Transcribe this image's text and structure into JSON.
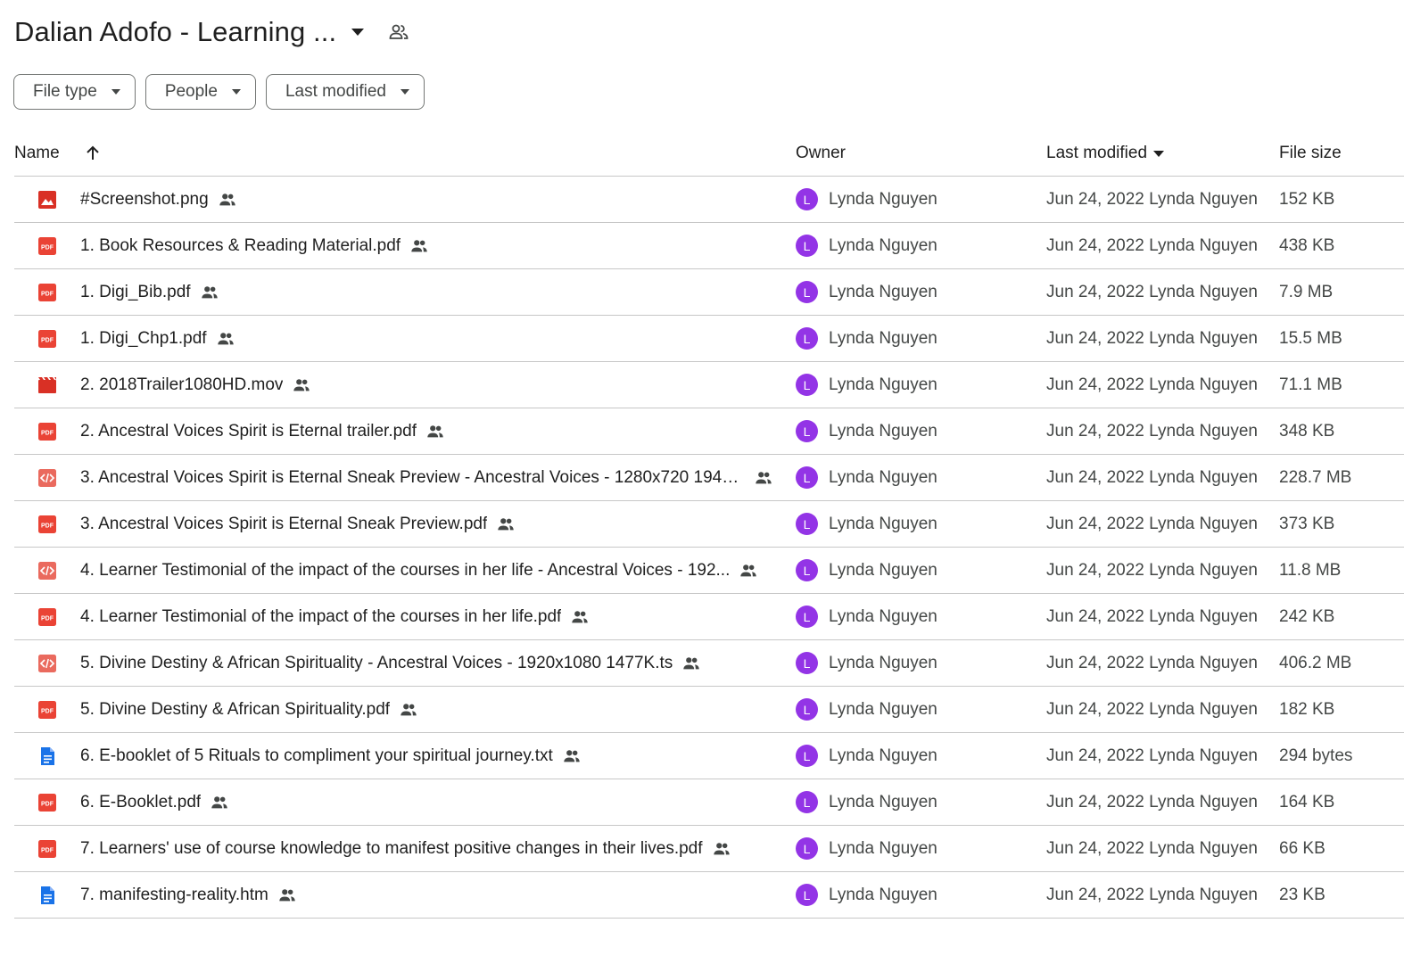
{
  "header": {
    "title": "Dalian Adofo - Learning ...",
    "title_caret": "arrow-drop-down-icon",
    "shared_icon": "shared-folder-icon"
  },
  "filters": [
    {
      "label": "File type"
    },
    {
      "label": "People"
    },
    {
      "label": "Last modified"
    }
  ],
  "columns": {
    "name": "Name",
    "owner": "Owner",
    "last_modified": "Last modified",
    "file_size": "File size"
  },
  "colors": {
    "avatar": "#9334e6",
    "pdf": "#ea4335",
    "image": "#d93025",
    "doc": "#1a73e8"
  },
  "files": [
    {
      "name": "#Screenshot.png",
      "type": "image",
      "owner_initial": "L",
      "owner": "Lynda Nguyen",
      "modified": "Jun 24, 2022 Lynda Nguyen",
      "size": "152 KB"
    },
    {
      "name": "1. Book Resources & Reading Material.pdf",
      "type": "pdf",
      "owner_initial": "L",
      "owner": "Lynda Nguyen",
      "modified": "Jun 24, 2022 Lynda Nguyen",
      "size": "438 KB"
    },
    {
      "name": "1. Digi_Bib.pdf",
      "type": "pdf",
      "owner_initial": "L",
      "owner": "Lynda Nguyen",
      "modified": "Jun 24, 2022 Lynda Nguyen",
      "size": "7.9 MB"
    },
    {
      "name": "1. Digi_Chp1.pdf",
      "type": "pdf",
      "owner_initial": "L",
      "owner": "Lynda Nguyen",
      "modified": "Jun 24, 2022 Lynda Nguyen",
      "size": "15.5 MB"
    },
    {
      "name": "2. 2018Trailer1080HD.mov",
      "type": "video",
      "owner_initial": "L",
      "owner": "Lynda Nguyen",
      "modified": "Jun 24, 2022 Lynda Nguyen",
      "size": "71.1 MB"
    },
    {
      "name": "2. Ancestral Voices Spirit is Eternal trailer.pdf",
      "type": "pdf",
      "owner_initial": "L",
      "owner": "Lynda Nguyen",
      "modified": "Jun 24, 2022 Lynda Nguyen",
      "size": "348 KB"
    },
    {
      "name": "3. Ancestral Voices Spirit is Eternal Sneak Preview - Ancestral Voices - 1280x720 1948...",
      "type": "code",
      "owner_initial": "L",
      "owner": "Lynda Nguyen",
      "modified": "Jun 24, 2022 Lynda Nguyen",
      "size": "228.7 MB"
    },
    {
      "name": "3. Ancestral Voices Spirit is Eternal Sneak Preview.pdf",
      "type": "pdf",
      "owner_initial": "L",
      "owner": "Lynda Nguyen",
      "modified": "Jun 24, 2022 Lynda Nguyen",
      "size": "373 KB"
    },
    {
      "name": "4. Learner Testimonial of the impact of the courses in her life - Ancestral Voices - 192...",
      "type": "code",
      "owner_initial": "L",
      "owner": "Lynda Nguyen",
      "modified": "Jun 24, 2022 Lynda Nguyen",
      "size": "11.8 MB"
    },
    {
      "name": "4. Learner Testimonial of the impact of the courses in her life.pdf",
      "type": "pdf",
      "owner_initial": "L",
      "owner": "Lynda Nguyen",
      "modified": "Jun 24, 2022 Lynda Nguyen",
      "size": "242 KB"
    },
    {
      "name": "5. Divine Destiny & African Spirituality - Ancestral Voices - 1920x1080 1477K.ts",
      "type": "code",
      "owner_initial": "L",
      "owner": "Lynda Nguyen",
      "modified": "Jun 24, 2022 Lynda Nguyen",
      "size": "406.2 MB"
    },
    {
      "name": "5. Divine Destiny & African Spirituality.pdf",
      "type": "pdf",
      "owner_initial": "L",
      "owner": "Lynda Nguyen",
      "modified": "Jun 24, 2022 Lynda Nguyen",
      "size": "182 KB"
    },
    {
      "name": "6. E-booklet of 5 Rituals to compliment your spiritual journey.txt",
      "type": "doc",
      "owner_initial": "L",
      "owner": "Lynda Nguyen",
      "modified": "Jun 24, 2022 Lynda Nguyen",
      "size": "294 bytes"
    },
    {
      "name": "6. E-Booklet.pdf",
      "type": "pdf",
      "owner_initial": "L",
      "owner": "Lynda Nguyen",
      "modified": "Jun 24, 2022 Lynda Nguyen",
      "size": "164 KB"
    },
    {
      "name": "7.  Learners' use of course knowledge to manifest positive changes in their lives.pdf",
      "type": "pdf",
      "owner_initial": "L",
      "owner": "Lynda Nguyen",
      "modified": "Jun 24, 2022 Lynda Nguyen",
      "size": "66 KB"
    },
    {
      "name": "7. manifesting-reality.htm",
      "type": "doc",
      "owner_initial": "L",
      "owner": "Lynda Nguyen",
      "modified": "Jun 24, 2022 Lynda Nguyen",
      "size": "23 KB"
    }
  ]
}
